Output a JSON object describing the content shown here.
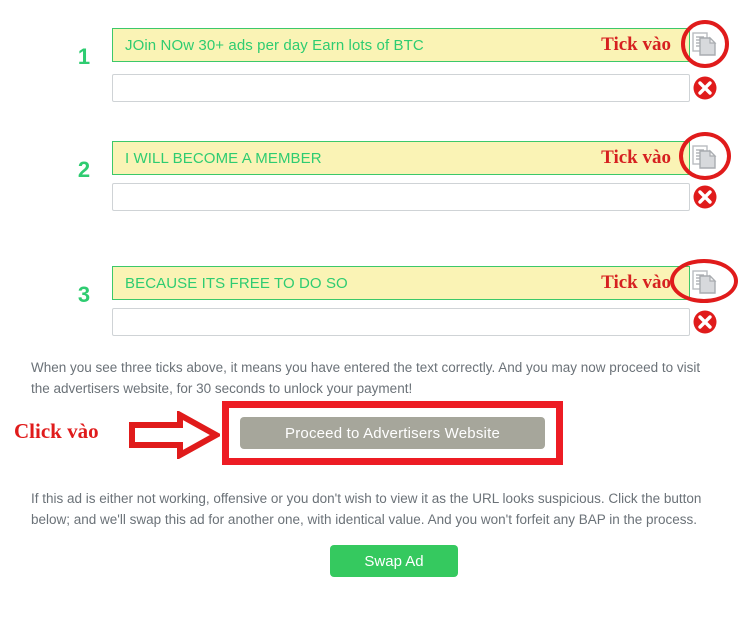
{
  "rows": [
    {
      "number": "1",
      "phrase": "JOin NOw 30+ ads per day Earn lots of BTC",
      "tick_label": "Tick vào",
      "input_value": "",
      "input_placeholder": "",
      "copy_icon": "copy-icon",
      "status_icon": "x-circle-icon"
    },
    {
      "number": "2",
      "phrase": "I WILL BECOME A MEMBER",
      "tick_label": "Tick vào",
      "input_value": "",
      "input_placeholder": "",
      "copy_icon": "copy-icon",
      "status_icon": "x-circle-icon"
    },
    {
      "number": "3",
      "phrase": "BECAUSE ITS FREE TO DO SO",
      "tick_label": "Tick vào",
      "input_value": "",
      "input_placeholder": "",
      "copy_icon": "copy-icon",
      "status_icon": "x-circle-icon"
    }
  ],
  "instructions": {
    "ticks_note": "When you see three ticks above, it means you have entered the text correctly. And you may now proceed to visit the advertisers website, for 30 seconds to unlock your payment!",
    "swap_note": "If this ad is either not working, offensive or you don't wish to view it as the URL looks suspicious. Click the button below; and we'll swap this ad for another one, with identical value. And you won't forfeit any BAP in the process."
  },
  "proceed": {
    "click_label": "Click vào",
    "button_label": "Proceed to Advertisers Website",
    "arrow_icon": "right-arrow-icon"
  },
  "swap": {
    "button_label": "Swap Ad"
  },
  "colors": {
    "banner_bg": "#faf3b5",
    "banner_border": "#3cc86a",
    "phrase_green": "#2ecc71",
    "annotation_red": "#e01b1b",
    "highlight_red": "#ed1c24",
    "proceed_grey": "#a6a69b",
    "swap_green": "#35c95f",
    "body_text": "#6b7278"
  }
}
